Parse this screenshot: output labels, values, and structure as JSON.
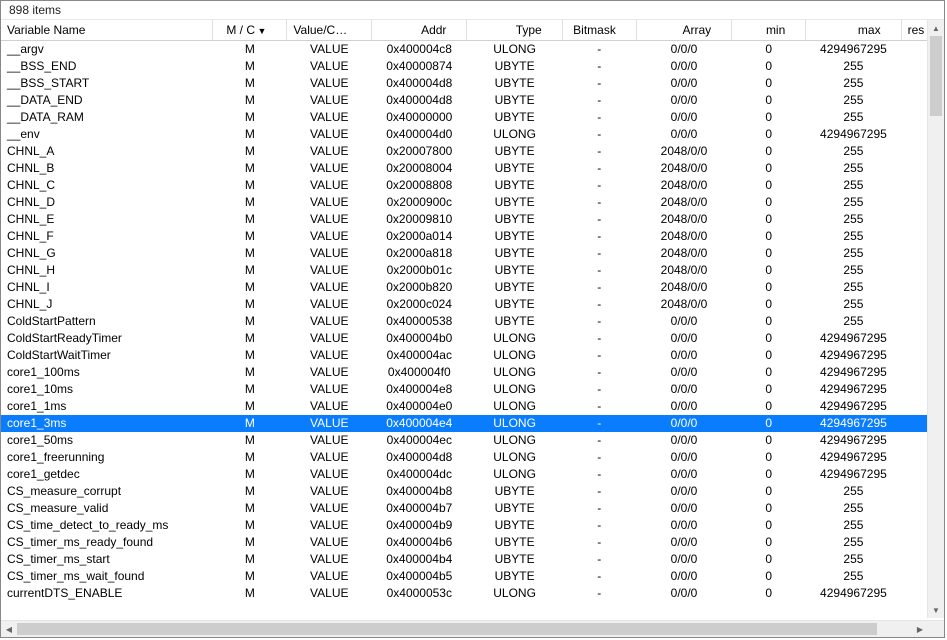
{
  "title": "898 items",
  "columns": {
    "variable": "Variable Name",
    "mc": "M / C",
    "value": "Value/Curv...",
    "addr": "Addr",
    "type": "Type",
    "bitmask": "Bitmask",
    "array": "Array",
    "min": "min",
    "max": "max",
    "res": "res"
  },
  "rows": [
    {
      "name": "__argv",
      "mc": "M",
      "value": "VALUE",
      "addr": "0x400004c8",
      "type": "ULONG",
      "bitmask": "-",
      "array": "0/0/0",
      "min": "0",
      "max": "4294967295",
      "sel": false
    },
    {
      "name": "__BSS_END",
      "mc": "M",
      "value": "VALUE",
      "addr": "0x40000874",
      "type": "UBYTE",
      "bitmask": "-",
      "array": "0/0/0",
      "min": "0",
      "max": "255",
      "sel": false
    },
    {
      "name": "__BSS_START",
      "mc": "M",
      "value": "VALUE",
      "addr": "0x400004d8",
      "type": "UBYTE",
      "bitmask": "-",
      "array": "0/0/0",
      "min": "0",
      "max": "255",
      "sel": false
    },
    {
      "name": "__DATA_END",
      "mc": "M",
      "value": "VALUE",
      "addr": "0x400004d8",
      "type": "UBYTE",
      "bitmask": "-",
      "array": "0/0/0",
      "min": "0",
      "max": "255",
      "sel": false
    },
    {
      "name": "__DATA_RAM",
      "mc": "M",
      "value": "VALUE",
      "addr": "0x40000000",
      "type": "UBYTE",
      "bitmask": "-",
      "array": "0/0/0",
      "min": "0",
      "max": "255",
      "sel": false
    },
    {
      "name": "__env",
      "mc": "M",
      "value": "VALUE",
      "addr": "0x400004d0",
      "type": "ULONG",
      "bitmask": "-",
      "array": "0/0/0",
      "min": "0",
      "max": "4294967295",
      "sel": false
    },
    {
      "name": "CHNL_A",
      "mc": "M",
      "value": "VALUE",
      "addr": "0x20007800",
      "type": "UBYTE",
      "bitmask": "-",
      "array": "2048/0/0",
      "min": "0",
      "max": "255",
      "sel": false
    },
    {
      "name": "CHNL_B",
      "mc": "M",
      "value": "VALUE",
      "addr": "0x20008004",
      "type": "UBYTE",
      "bitmask": "-",
      "array": "2048/0/0",
      "min": "0",
      "max": "255",
      "sel": false
    },
    {
      "name": "CHNL_C",
      "mc": "M",
      "value": "VALUE",
      "addr": "0x20008808",
      "type": "UBYTE",
      "bitmask": "-",
      "array": "2048/0/0",
      "min": "0",
      "max": "255",
      "sel": false
    },
    {
      "name": "CHNL_D",
      "mc": "M",
      "value": "VALUE",
      "addr": "0x2000900c",
      "type": "UBYTE",
      "bitmask": "-",
      "array": "2048/0/0",
      "min": "0",
      "max": "255",
      "sel": false
    },
    {
      "name": "CHNL_E",
      "mc": "M",
      "value": "VALUE",
      "addr": "0x20009810",
      "type": "UBYTE",
      "bitmask": "-",
      "array": "2048/0/0",
      "min": "0",
      "max": "255",
      "sel": false
    },
    {
      "name": "CHNL_F",
      "mc": "M",
      "value": "VALUE",
      "addr": "0x2000a014",
      "type": "UBYTE",
      "bitmask": "-",
      "array": "2048/0/0",
      "min": "0",
      "max": "255",
      "sel": false
    },
    {
      "name": "CHNL_G",
      "mc": "M",
      "value": "VALUE",
      "addr": "0x2000a818",
      "type": "UBYTE",
      "bitmask": "-",
      "array": "2048/0/0",
      "min": "0",
      "max": "255",
      "sel": false
    },
    {
      "name": "CHNL_H",
      "mc": "M",
      "value": "VALUE",
      "addr": "0x2000b01c",
      "type": "UBYTE",
      "bitmask": "-",
      "array": "2048/0/0",
      "min": "0",
      "max": "255",
      "sel": false
    },
    {
      "name": "CHNL_I",
      "mc": "M",
      "value": "VALUE",
      "addr": "0x2000b820",
      "type": "UBYTE",
      "bitmask": "-",
      "array": "2048/0/0",
      "min": "0",
      "max": "255",
      "sel": false
    },
    {
      "name": "CHNL_J",
      "mc": "M",
      "value": "VALUE",
      "addr": "0x2000c024",
      "type": "UBYTE",
      "bitmask": "-",
      "array": "2048/0/0",
      "min": "0",
      "max": "255",
      "sel": false
    },
    {
      "name": "ColdStartPattern",
      "mc": "M",
      "value": "VALUE",
      "addr": "0x40000538",
      "type": "UBYTE",
      "bitmask": "-",
      "array": "0/0/0",
      "min": "0",
      "max": "255",
      "sel": false
    },
    {
      "name": "ColdStartReadyTimer",
      "mc": "M",
      "value": "VALUE",
      "addr": "0x400004b0",
      "type": "ULONG",
      "bitmask": "-",
      "array": "0/0/0",
      "min": "0",
      "max": "4294967295",
      "sel": false
    },
    {
      "name": "ColdStartWaitTimer",
      "mc": "M",
      "value": "VALUE",
      "addr": "0x400004ac",
      "type": "ULONG",
      "bitmask": "-",
      "array": "0/0/0",
      "min": "0",
      "max": "4294967295",
      "sel": false
    },
    {
      "name": "core1_100ms",
      "mc": "M",
      "value": "VALUE",
      "addr": "0x400004f0",
      "type": "ULONG",
      "bitmask": "-",
      "array": "0/0/0",
      "min": "0",
      "max": "4294967295",
      "sel": false
    },
    {
      "name": "core1_10ms",
      "mc": "M",
      "value": "VALUE",
      "addr": "0x400004e8",
      "type": "ULONG",
      "bitmask": "-",
      "array": "0/0/0",
      "min": "0",
      "max": "4294967295",
      "sel": false
    },
    {
      "name": "core1_1ms",
      "mc": "M",
      "value": "VALUE",
      "addr": "0x400004e0",
      "type": "ULONG",
      "bitmask": "-",
      "array": "0/0/0",
      "min": "0",
      "max": "4294967295",
      "sel": false
    },
    {
      "name": "core1_3ms",
      "mc": "M",
      "value": "VALUE",
      "addr": "0x400004e4",
      "type": "ULONG",
      "bitmask": "-",
      "array": "0/0/0",
      "min": "0",
      "max": "4294967295",
      "sel": true
    },
    {
      "name": "core1_50ms",
      "mc": "M",
      "value": "VALUE",
      "addr": "0x400004ec",
      "type": "ULONG",
      "bitmask": "-",
      "array": "0/0/0",
      "min": "0",
      "max": "4294967295",
      "sel": false
    },
    {
      "name": "core1_freerunning",
      "mc": "M",
      "value": "VALUE",
      "addr": "0x400004d8",
      "type": "ULONG",
      "bitmask": "-",
      "array": "0/0/0",
      "min": "0",
      "max": "4294967295",
      "sel": false
    },
    {
      "name": "core1_getdec",
      "mc": "M",
      "value": "VALUE",
      "addr": "0x400004dc",
      "type": "ULONG",
      "bitmask": "-",
      "array": "0/0/0",
      "min": "0",
      "max": "4294967295",
      "sel": false
    },
    {
      "name": "CS_measure_corrupt",
      "mc": "M",
      "value": "VALUE",
      "addr": "0x400004b8",
      "type": "UBYTE",
      "bitmask": "-",
      "array": "0/0/0",
      "min": "0",
      "max": "255",
      "sel": false
    },
    {
      "name": "CS_measure_valid",
      "mc": "M",
      "value": "VALUE",
      "addr": "0x400004b7",
      "type": "UBYTE",
      "bitmask": "-",
      "array": "0/0/0",
      "min": "0",
      "max": "255",
      "sel": false
    },
    {
      "name": "CS_time_detect_to_ready_ms",
      "mc": "M",
      "value": "VALUE",
      "addr": "0x400004b9",
      "type": "UBYTE",
      "bitmask": "-",
      "array": "0/0/0",
      "min": "0",
      "max": "255",
      "sel": false
    },
    {
      "name": "CS_timer_ms_ready_found",
      "mc": "M",
      "value": "VALUE",
      "addr": "0x400004b6",
      "type": "UBYTE",
      "bitmask": "-",
      "array": "0/0/0",
      "min": "0",
      "max": "255",
      "sel": false
    },
    {
      "name": "CS_timer_ms_start",
      "mc": "M",
      "value": "VALUE",
      "addr": "0x400004b4",
      "type": "UBYTE",
      "bitmask": "-",
      "array": "0/0/0",
      "min": "0",
      "max": "255",
      "sel": false
    },
    {
      "name": "CS_timer_ms_wait_found",
      "mc": "M",
      "value": "VALUE",
      "addr": "0x400004b5",
      "type": "UBYTE",
      "bitmask": "-",
      "array": "0/0/0",
      "min": "0",
      "max": "255",
      "sel": false
    },
    {
      "name": "currentDTS_ENABLE",
      "mc": "M",
      "value": "VALUE",
      "addr": "0x4000053c",
      "type": "ULONG",
      "bitmask": "-",
      "array": "0/0/0",
      "min": "0",
      "max": "4294967295",
      "sel": false
    }
  ]
}
